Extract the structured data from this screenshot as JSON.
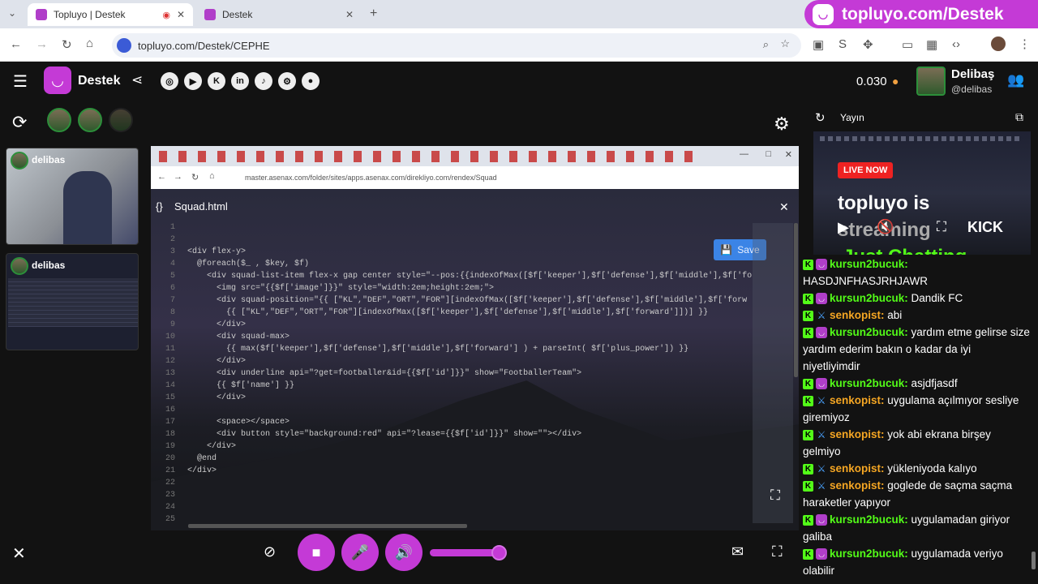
{
  "browser": {
    "tabs": [
      {
        "title": "Topluyo | Destek",
        "active": true
      },
      {
        "title": "Destek",
        "active": false
      }
    ],
    "url": "topluyo.com/Destek/CEPHE",
    "banner_text": "topluyo.com/Destek"
  },
  "header": {
    "app_name": "Destek",
    "balance": "0.030",
    "user_name": "Delibaş",
    "user_handle": "@delibas",
    "social_icons": [
      "instagram-icon",
      "youtube-icon",
      "kick-icon",
      "linkedin-icon",
      "tiktok-icon",
      "steam-icon",
      "github-icon"
    ]
  },
  "participants": {
    "tiles": [
      {
        "name": "delibas"
      },
      {
        "name": "delibas"
      }
    ]
  },
  "share": {
    "inner_url": "master.asenax.com/folder/sites/apps.asenax.com/direkliyo.com/rendex/Squad",
    "file_name": "Squad.html",
    "save_label": "Save",
    "code_lines": [
      {
        "n": "1",
        "t": ""
      },
      {
        "n": "2",
        "t": ""
      },
      {
        "n": "3",
        "t": "<div flex-y>"
      },
      {
        "n": "4",
        "t": "  @foreach($_ , $key, $f)"
      },
      {
        "n": "5",
        "t": "    <div squad-list-item flex-x gap center style=\"--pos:{{indexOfMax([$f['keeper'],$f['defense'],$f['middle'],$f['fo"
      },
      {
        "n": "6",
        "t": "      <img src=\"{{$f['image']}}\" style=\"width:2em;height:2em;\">"
      },
      {
        "n": "7",
        "t": "      <div squad-position=\"{{ [\"KL\",\"DEF\",\"ORT\",\"FOR\"][indexOfMax([$f['keeper'],$f['defense'],$f['middle'],$f['forw"
      },
      {
        "n": "8",
        "t": "        {{ [\"KL\",\"DEF\",\"ORT\",\"FOR\"][indexOfMax([$f['keeper'],$f['defense'],$f['middle'],$f['forward']])] }}"
      },
      {
        "n": "9",
        "t": "      </div>"
      },
      {
        "n": "10",
        "t": "      <div squad-max>"
      },
      {
        "n": "11",
        "t": "        {{ max($f['keeper'],$f['defense'],$f['middle'],$f['forward'] ) + parseInt( $f['plus_power']) }}"
      },
      {
        "n": "12",
        "t": "      </div>"
      },
      {
        "n": "13",
        "t": "      <div underline api=\"?get=footballer&id={{$f['id']}}\" show=\"FootballerTeam\">"
      },
      {
        "n": "14",
        "t": "      {{ $f['name'] }}"
      },
      {
        "n": "15",
        "t": "      </div>"
      },
      {
        "n": "16",
        "t": ""
      },
      {
        "n": "17",
        "t": "      <space></space>"
      },
      {
        "n": "18",
        "t": "      <div button style=\"background:red\" api=\"?lease={{$f['id']}}\" show=\"\"></div>"
      },
      {
        "n": "19",
        "t": "    </div>"
      },
      {
        "n": "20",
        "t": "  @end"
      },
      {
        "n": "21",
        "t": "</div>"
      },
      {
        "n": "22",
        "t": ""
      },
      {
        "n": "23",
        "t": ""
      },
      {
        "n": "24",
        "t": ""
      },
      {
        "n": "25",
        "t": ""
      }
    ]
  },
  "stream": {
    "label": "Yayın",
    "live_badge": "LIVE NOW",
    "title_line1": "topluyo is",
    "title_line2": "streaming",
    "title_line3": "Just Chatting",
    "kick_label": "KICK"
  },
  "chat": {
    "messages": [
      {
        "user": "kursun2bucuk",
        "text": "HASDJNFHASJRHJAWR",
        "badge": "sub",
        "cls": "u-kursun"
      },
      {
        "user": "kursun2bucuk",
        "text": "Dandik FC",
        "badge": "sub",
        "cls": "u-kursun"
      },
      {
        "user": "senkopist",
        "text": "abi",
        "badge": "sword",
        "cls": "u-senko"
      },
      {
        "user": "kursun2bucuk",
        "text": "yardım etme gelirse size yardım ederim bakın o kadar da iyi niyetliyimdir",
        "badge": "sub",
        "cls": "u-kursun"
      },
      {
        "user": "kursun2bucuk",
        "text": "asjdfjasdf",
        "badge": "sub",
        "cls": "u-kursun"
      },
      {
        "user": "senkopist",
        "text": "uygulama açılmıyor sesliye giremiyoz",
        "badge": "sword",
        "cls": "u-senko"
      },
      {
        "user": "senkopist",
        "text": "yok abi ekrana birşey gelmiyo",
        "badge": "sword",
        "cls": "u-senko"
      },
      {
        "user": "senkopist",
        "text": "yükleniyoda kalıyo",
        "badge": "sword",
        "cls": "u-senko"
      },
      {
        "user": "senkopist",
        "text": "goglede de saçma saçma haraketler yapıyor",
        "badge": "sword",
        "cls": "u-senko"
      },
      {
        "user": "kursun2bucuk",
        "text": "uygulamadan giriyor galiba",
        "badge": "sub",
        "cls": "u-kursun"
      },
      {
        "user": "kursun2bucuk",
        "text": "uygulamada veriyo olabilir",
        "badge": "sub",
        "cls": "u-kursun"
      }
    ]
  },
  "colors": {
    "accent": "#c43ad6",
    "kick": "#53fc18",
    "save": "#3b84e6"
  }
}
